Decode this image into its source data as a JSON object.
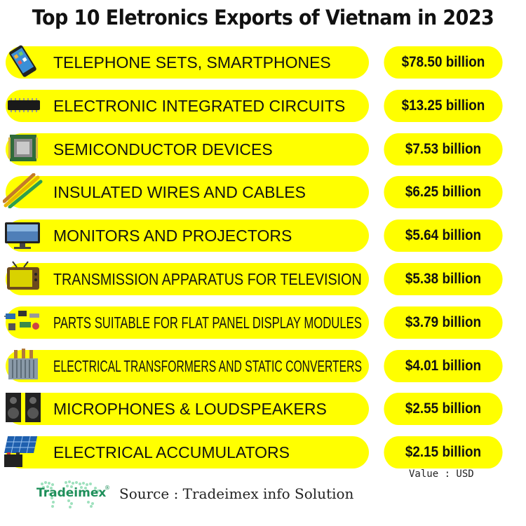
{
  "title": "Top 10 Eletronics Exports of Vietnam in 2023",
  "items": [
    {
      "label": "TELEPHONE SETS, SMARTPHONES",
      "value": "$78.50 billion",
      "icon": "smartphone-icon"
    },
    {
      "label": "ELECTRONIC INTEGRATED CIRCUITS",
      "value": "$13.25 billion",
      "icon": "chip-icon"
    },
    {
      "label": "SEMICONDUCTOR DEVICES",
      "value": "$7.53 billion",
      "icon": "processor-icon"
    },
    {
      "label": "INSULATED WIRES AND CABLES",
      "value": "$6.25 billion",
      "icon": "cables-icon"
    },
    {
      "label": "MONITORS AND PROJECTORS",
      "value": "$5.64 billion",
      "icon": "monitor-icon"
    },
    {
      "label": "TRANSMISSION APPARATUS FOR TELEVISION",
      "value": "$5.38 billion",
      "icon": "television-icon"
    },
    {
      "label": "PARTS SUITABLE FOR FLAT PANEL DISPLAY MODULES",
      "value": "$3.79 billion",
      "icon": "components-icon"
    },
    {
      "label": "ELECTRICAL TRANSFORMERS AND STATIC CONVERTERS",
      "value": "$4.01 billion",
      "icon": "transformer-icon"
    },
    {
      "label": "MICROPHONES & LOUDSPEAKERS",
      "value": "$2.55 billion",
      "icon": "speakers-icon"
    },
    {
      "label": "ELECTRICAL ACCUMULATORS",
      "value": "$2.15 billion",
      "icon": "battery-solar-icon"
    }
  ],
  "unit_note": "Value : USD",
  "source": "Source : Tradeimex info Solution",
  "logo": {
    "name": "Tradeimex",
    "mark": "®"
  },
  "colors": {
    "pill": "#ffff00",
    "text": "#111111",
    "logo_text": "#1e8f5a",
    "map": "#7fd6a8"
  },
  "chart_data": {
    "type": "table",
    "title": "Top 10 Eletronics Exports of Vietnam in 2023",
    "categories": [
      "TELEPHONE SETS, SMARTPHONES",
      "ELECTRONIC INTEGRATED CIRCUITS",
      "SEMICONDUCTOR DEVICES",
      "INSULATED WIRES AND CABLES",
      "MONITORS AND PROJECTORS",
      "TRANSMISSION APPARATUS FOR TELEVISION",
      "PARTS SUITABLE FOR FLAT PANEL DISPLAY MODULES",
      "ELECTRICAL TRANSFORMERS AND STATIC CONVERTERS",
      "MICROPHONES & LOUDSPEAKERS",
      "ELECTRICAL ACCUMULATORS"
    ],
    "values": [
      78.5,
      13.25,
      7.53,
      6.25,
      5.64,
      5.38,
      3.79,
      4.01,
      2.55,
      2.15
    ],
    "unit": "USD billion"
  }
}
